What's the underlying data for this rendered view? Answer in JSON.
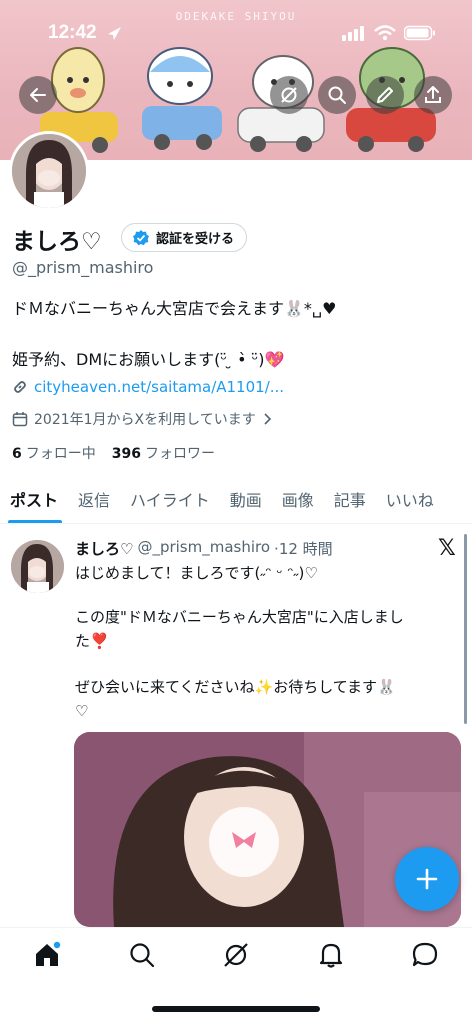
{
  "status_bar": {
    "time": "12:42"
  },
  "banner": {
    "text": "ODEKAKE SHIYOU"
  },
  "profile": {
    "display_name": "ましろ♡",
    "verify_label": "認証を受ける",
    "handle": "@_prism_mashiro",
    "bio_line1": "ドＭなバニーちゃん大宮店で会えます🐰*␣♥",
    "bio_line2": "姫予約、DMにお願いします(ᵕ̈ ̮ •̀ ᵕ̈)💖",
    "link": "cityheaven.net/saitama/A1101/...",
    "joined": "2021年1月からXを利用しています",
    "following_count": "6",
    "following_label": "フォロー中",
    "followers_count": "396",
    "followers_label": "フォロワー"
  },
  "tabs": [
    {
      "label": "ポスト",
      "active": true
    },
    {
      "label": "返信"
    },
    {
      "label": "ハイライト"
    },
    {
      "label": "動画"
    },
    {
      "label": "画像"
    },
    {
      "label": "記事"
    },
    {
      "label": "いいね"
    }
  ],
  "post": {
    "name": "ましろ♡",
    "handle": "@_prism_mashiro",
    "time": "·12 時間",
    "line1": "はじめまして！ましろです(˶ᵔ ᵕ ᵔ˶)♡",
    "line2": "この度\"ドＭなバニーちゃん大宮店\"に入店しまし",
    "line3": "た❣️",
    "line4": "ぜひ会いに来てくださいね✨お待ちしてます🐰",
    "line5": "♡"
  },
  "icons": {
    "back": "back-arrow-icon",
    "grok": "grok-icon",
    "search": "search-icon",
    "edit": "pencil-icon",
    "share": "share-icon",
    "home": "home-icon",
    "notifications": "bell-icon",
    "messages": "chat-icon",
    "compose": "plus-icon"
  },
  "colors": {
    "accent": "#1d9bf0",
    "text": "#0f1419",
    "secondary": "#536471"
  }
}
